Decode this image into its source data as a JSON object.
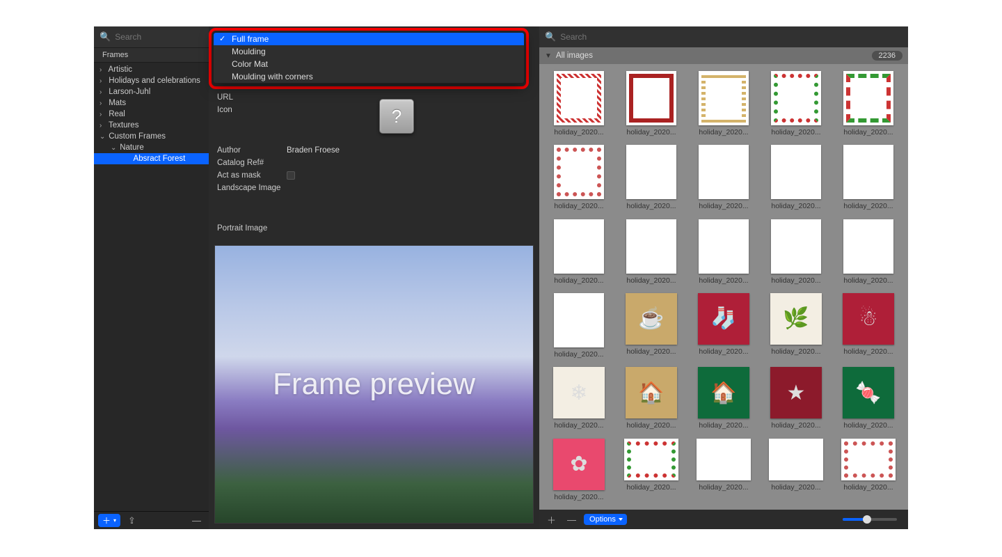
{
  "sidebar": {
    "search_placeholder": "Search",
    "header": "Frames",
    "tree": [
      {
        "label": "Artistic",
        "depth": 0,
        "expanded": false
      },
      {
        "label": "Holidays and celebrations",
        "depth": 0,
        "expanded": false
      },
      {
        "label": "Larson-Juhl",
        "depth": 0,
        "expanded": false
      },
      {
        "label": "Mats",
        "depth": 0,
        "expanded": false
      },
      {
        "label": "Real",
        "depth": 0,
        "expanded": false
      },
      {
        "label": "Textures",
        "depth": 0,
        "expanded": false
      },
      {
        "label": "Custom Frames",
        "depth": 0,
        "expanded": true
      },
      {
        "label": "Nature",
        "depth": 1,
        "expanded": true
      },
      {
        "label": "Absract Forest",
        "depth": 2,
        "selected": true
      }
    ]
  },
  "dropdown": {
    "options": [
      {
        "label": "Full frame",
        "selected": true
      },
      {
        "label": "Moulding",
        "selected": false
      },
      {
        "label": "Color Mat",
        "selected": false
      },
      {
        "label": "Moulding with corners",
        "selected": false
      }
    ]
  },
  "form": {
    "url_label": "URL",
    "icon_label": "Icon",
    "author_label": "Author",
    "author_value": "Braden Froese",
    "catalog_label": "Catalog Ref#",
    "mask_label": "Act as mask",
    "landscape_label": "Landscape Image",
    "portrait_label": "Portrait Image",
    "icon_glyph": "?"
  },
  "preview": {
    "text": "Frame preview"
  },
  "right": {
    "search_placeholder": "Search",
    "header_label": "All images",
    "count": "2236",
    "options_label": "Options",
    "thumb_label": "holiday_2020...",
    "slider_value": 0.45
  },
  "thumbnails": [
    {
      "kind": "portrait",
      "style": "bf-red"
    },
    {
      "kind": "portrait",
      "style": "bf-crim"
    },
    {
      "kind": "portrait",
      "style": "bf-gold"
    },
    {
      "kind": "portrait",
      "style": "bf-dots-rg"
    },
    {
      "kind": "portrait",
      "style": "bf-sq"
    },
    {
      "kind": "portrait",
      "style": "bf-hearts"
    },
    {
      "kind": "portrait",
      "style": "bf-blank"
    },
    {
      "kind": "portrait",
      "style": "bf-blank"
    },
    {
      "kind": "portrait",
      "style": "bf-blank"
    },
    {
      "kind": "portrait",
      "style": "bf-blank"
    },
    {
      "kind": "portrait",
      "style": "bf-blank"
    },
    {
      "kind": "portrait",
      "style": "bf-blank"
    },
    {
      "kind": "portrait",
      "style": "bf-blank"
    },
    {
      "kind": "portrait",
      "style": "bf-blank"
    },
    {
      "kind": "portrait",
      "style": "bf-blank"
    },
    {
      "kind": "portrait",
      "style": "bf-blank"
    },
    {
      "kind": "solid",
      "bg": "bg-tan",
      "glyph": "☕"
    },
    {
      "kind": "solid",
      "bg": "bg-red",
      "glyph": "🧦"
    },
    {
      "kind": "solid",
      "bg": "bg-cream",
      "glyph": "🌿"
    },
    {
      "kind": "solid",
      "bg": "bg-red",
      "glyph": "☃"
    },
    {
      "kind": "solid",
      "bg": "bg-cream",
      "glyph": "❄"
    },
    {
      "kind": "solid",
      "bg": "bg-tan",
      "glyph": "🏠"
    },
    {
      "kind": "solid",
      "bg": "bg-green",
      "glyph": "🏠"
    },
    {
      "kind": "solid",
      "bg": "bg-crim",
      "glyph": "★"
    },
    {
      "kind": "solid",
      "bg": "bg-green",
      "glyph": "🍬"
    },
    {
      "kind": "solid",
      "bg": "bg-pink",
      "glyph": "✿"
    },
    {
      "kind": "landscape",
      "style": "bf-dots-rg"
    },
    {
      "kind": "landscape",
      "style": "bf-blank"
    },
    {
      "kind": "landscape",
      "style": "bf-blank"
    },
    {
      "kind": "landscape",
      "style": "bf-hearts"
    }
  ]
}
